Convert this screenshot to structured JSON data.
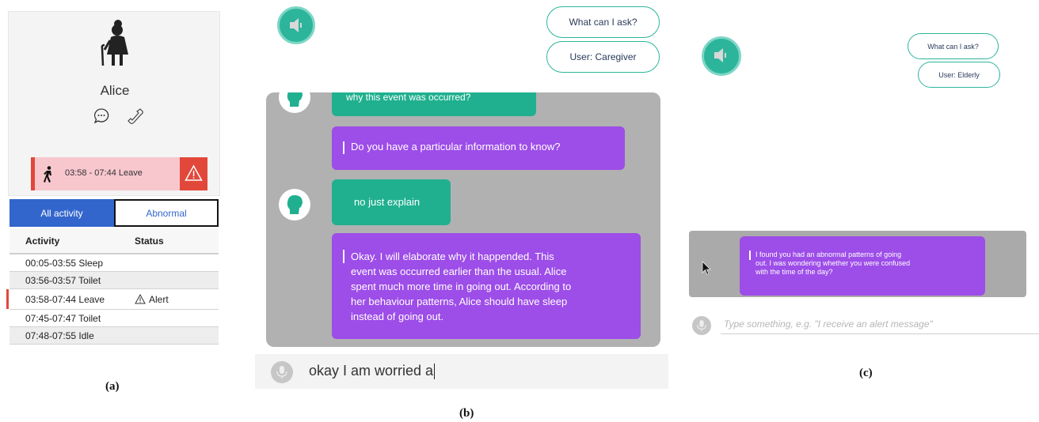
{
  "panel_a": {
    "name": "Alice",
    "alert": {
      "time_range": "03:58 - 07:44",
      "activity": "Leave"
    },
    "tabs": [
      {
        "label": "All activity",
        "active": true
      },
      {
        "label": "Abnormal",
        "active": false
      }
    ],
    "table": {
      "headers": [
        "Activity",
        "Status"
      ],
      "rows": [
        {
          "activity": "00:05-03:55 Sleep",
          "status": ""
        },
        {
          "activity": "03:56-03:57 Toilet",
          "status": ""
        },
        {
          "activity": "03:58-07:44 Leave",
          "status": "Alert"
        },
        {
          "activity": "07:45-07:47 Toilet",
          "status": ""
        },
        {
          "activity": "07:48-07:55 Idle",
          "status": ""
        }
      ]
    },
    "caption": "(a)"
  },
  "panel_b": {
    "buttons": {
      "ask": "What can I ask?",
      "user": "User: Caregiver"
    },
    "messages": [
      {
        "from": "user",
        "text": "why this event was occurred?"
      },
      {
        "from": "bot",
        "text": "Do you have a particular information to know?"
      },
      {
        "from": "user",
        "text": "no just explain"
      },
      {
        "from": "bot",
        "lines": [
          "Okay. I will elaborate why it happended. This",
          "event was occurred earlier than the usual. Alice",
          "spent much more time in going out. According to",
          "her behaviour patterns, Alice should have sleep",
          "instead of going out."
        ]
      }
    ],
    "input_value": "okay I am worried a",
    "caption": "(b)"
  },
  "panel_c": {
    "buttons": {
      "ask": "What can I ask?",
      "user": "User: Elderly"
    },
    "message_lines": [
      "I found you had an abnormal patterns of going",
      "out. I was wondering whether you were confused",
      "with the time of the day?"
    ],
    "input_placeholder": "Type something, e.g. \"I receive an alert message\"",
    "caption": "(c)"
  },
  "colors": {
    "teal": "#2cb59b",
    "purple": "#9d4de8",
    "alert_red": "#e2483a",
    "alert_pink": "#f8c7ce",
    "tab_blue": "#3366cc"
  }
}
